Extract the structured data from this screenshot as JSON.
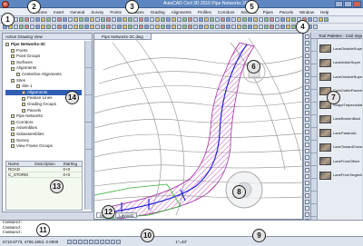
{
  "window": {
    "title": "AutoCAD Civil 3D 2010  Pipe Networks 3C.dwg"
  },
  "menu": {
    "items": [
      "Home",
      "Insert",
      "General",
      "Survey",
      "Points",
      "Surfaces",
      "Grading",
      "Alignments",
      "Profiles",
      "Corridors",
      "Sections",
      "Pipes",
      "Parcels",
      "Window",
      "Help"
    ]
  },
  "prospector": {
    "header": "Active Drawing View",
    "tree": [
      {
        "label": "Pipe Networks-3C",
        "level": 0,
        "selected": false,
        "bold": true
      },
      {
        "label": "Points",
        "level": 1,
        "selected": false,
        "bold": false
      },
      {
        "label": "Point Groups",
        "level": 1,
        "selected": false,
        "bold": false
      },
      {
        "label": "Surfaces",
        "level": 1,
        "selected": false,
        "bold": false
      },
      {
        "label": "Alignments",
        "level": 1,
        "selected": false,
        "bold": false
      },
      {
        "label": "Centerline Alignments",
        "level": 2,
        "selected": false,
        "bold": false
      },
      {
        "label": "Sites",
        "level": 1,
        "selected": false,
        "bold": false
      },
      {
        "label": "Site 1",
        "level": 2,
        "selected": false,
        "bold": false
      },
      {
        "label": "Alignments",
        "level": 3,
        "selected": true,
        "bold": false
      },
      {
        "label": "Feature Lines",
        "level": 3,
        "selected": false,
        "bold": false
      },
      {
        "label": "Grading Groups",
        "level": 3,
        "selected": false,
        "bold": false
      },
      {
        "label": "Parcels",
        "level": 3,
        "selected": false,
        "bold": false
      },
      {
        "label": "Pipe Networks",
        "level": 1,
        "selected": false,
        "bold": false
      },
      {
        "label": "Corridors",
        "level": 1,
        "selected": false,
        "bold": false
      },
      {
        "label": "Assemblies",
        "level": 1,
        "selected": false,
        "bold": false
      },
      {
        "label": "Subassemblies",
        "level": 1,
        "selected": false,
        "bold": false
      },
      {
        "label": "Survey",
        "level": 1,
        "selected": false,
        "bold": false
      },
      {
        "label": "View Frame Groups",
        "level": 1,
        "selected": false,
        "bold": false
      }
    ],
    "table": {
      "columns": [
        "Name",
        "Description",
        "Starting"
      ],
      "rows": [
        [
          "ROAD",
          "",
          "0+0"
        ],
        [
          "C_STORM",
          "",
          "0+0"
        ]
      ]
    }
  },
  "drawing": {
    "tab_label": "Pipe Networks-3C.dwg",
    "layout_tabs": [
      "Model",
      "Layout1"
    ]
  },
  "palette": {
    "header": "Tool Palettes - Civil Imperial Subassemblies",
    "items": [
      "LaneOutsideSuper",
      "LaneInsideSuper",
      "LaneOutsideSuperWithWidening",
      "CurbGutterPavementStructure",
      "ShapeTrapezoidal",
      "LaneBrokenBack",
      "LaneParabolic",
      "LaneTowardCrown",
      "LaneFromOffset",
      "LaneFromTargetAndShoulder"
    ]
  },
  "command_line": {
    "lines": [
      "Command:",
      "Command:",
      "Command:"
    ]
  },
  "status": {
    "coords": "5710.8773, 4706.1953, 0.0000",
    "scale": "1\"=40'"
  },
  "callouts": [
    {
      "num": "1",
      "style": "white"
    },
    {
      "num": "2",
      "style": "white"
    },
    {
      "num": "3",
      "style": "white"
    },
    {
      "num": "4",
      "style": "white"
    },
    {
      "num": "5",
      "style": "white"
    },
    {
      "num": "6",
      "style": "gray"
    },
    {
      "num": "7",
      "style": "gray"
    },
    {
      "num": "8",
      "style": "gray"
    },
    {
      "num": "9",
      "style": "gray"
    },
    {
      "num": "10",
      "style": "gray"
    },
    {
      "num": "11",
      "style": "white"
    },
    {
      "num": "12",
      "style": "gray"
    },
    {
      "num": "13",
      "style": "gray"
    },
    {
      "num": "14",
      "style": "gray"
    }
  ],
  "colors": {
    "title_bar": "#5e86c0",
    "alignment_hatch": "#c050c0",
    "pipe_network": "#2020d8",
    "contours": "#707070",
    "selected_item": "#2f5fb5"
  }
}
